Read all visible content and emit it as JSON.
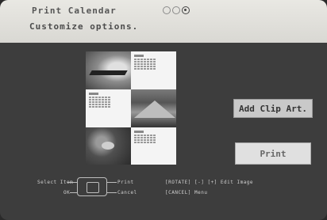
{
  "header": {
    "title": "Print Calendar",
    "subtitle": "Customize options.",
    "page_indicators": [
      "circle-indicator",
      "circle-indicator",
      "circle-indicator-active"
    ]
  },
  "preview": {
    "cells": [
      "photo",
      "calendar",
      "calendar",
      "photo",
      "photo",
      "calendar"
    ]
  },
  "buttons": {
    "add_clip_art": "Add Clip Art.",
    "print": "Print"
  },
  "help": {
    "select_item": "Select Item",
    "ok": "OK",
    "print": "Print",
    "cancel": "Cancel",
    "rotate": "[ROTATE]  [-]  [+]  Edit Image",
    "menu": "[CANCEL]  Menu"
  },
  "colors": {
    "header_bg": "#e2e1dc",
    "screen_bg": "#3d3d3d",
    "button_bg": "#d6d6d6"
  }
}
